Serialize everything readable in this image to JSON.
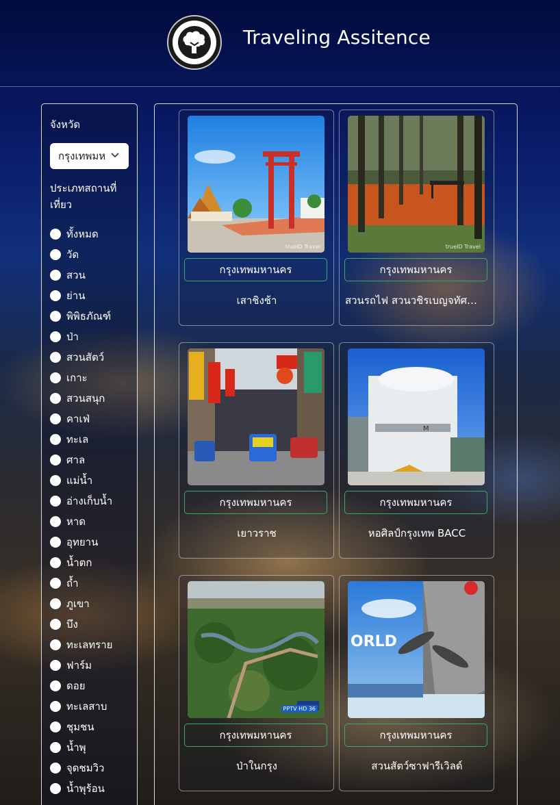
{
  "header": {
    "title": "Traveling Assitence",
    "logo_icon": "tree-icon"
  },
  "sidebar": {
    "province_label": "จังหวัด",
    "province_select_value": "กรุงเทพมหานคร",
    "category_label": "ประเภทสถานที่เที่ยว",
    "categories": [
      {
        "label": "ทั้งหมด"
      },
      {
        "label": "วัด"
      },
      {
        "label": "สวน"
      },
      {
        "label": "ย่าน"
      },
      {
        "label": "พิพิธภัณฑ์"
      },
      {
        "label": "ป่า"
      },
      {
        "label": "สวนสัตว์"
      },
      {
        "label": "เกาะ"
      },
      {
        "label": "สวนสนุก"
      },
      {
        "label": "คาเฟ่"
      },
      {
        "label": "ทะเล"
      },
      {
        "label": "ศาล"
      },
      {
        "label": "แม่น้ำ"
      },
      {
        "label": "อ่างเก็บน้ำ"
      },
      {
        "label": "หาด"
      },
      {
        "label": "อุทยาน"
      },
      {
        "label": "น้ำตก"
      },
      {
        "label": "ถ้ำ"
      },
      {
        "label": "ภูเขา"
      },
      {
        "label": "บึง"
      },
      {
        "label": "ทะเลทราย"
      },
      {
        "label": "ฟาร์ม"
      },
      {
        "label": "ดอย"
      },
      {
        "label": "ทะเลสาบ"
      },
      {
        "label": "ชุมชน"
      },
      {
        "label": "น้ำพุ"
      },
      {
        "label": "จุดชมวิว"
      },
      {
        "label": "น้ำพุร้อน"
      }
    ]
  },
  "cards": [
    {
      "province": "กรุงเทพมหานคร",
      "name": "เสาชิงช้า",
      "watermark": "trueID Travel"
    },
    {
      "province": "กรุงเทพมหานคร",
      "name": "สวนรถไฟ สวนวชิรเบญจทัศ ...",
      "watermark": "trueID Travel"
    },
    {
      "province": "กรุงเทพมหานคร",
      "name": "เยาวราช",
      "watermark": ""
    },
    {
      "province": "กรุงเทพมหานคร",
      "name": "หอศิลป์กรุงเทพ BACC",
      "watermark": ""
    },
    {
      "province": "กรุงเทพมหานคร",
      "name": "ป่าในกรุง",
      "watermark": "PPTV HD 36"
    },
    {
      "province": "กรุงเทพมหานคร",
      "name": "สวนสัตว์ซาฟารีเวิลด์",
      "watermark": "ORLD"
    }
  ],
  "colors": {
    "province_border": "#3aa86b",
    "background_top": "#020b3d"
  }
}
